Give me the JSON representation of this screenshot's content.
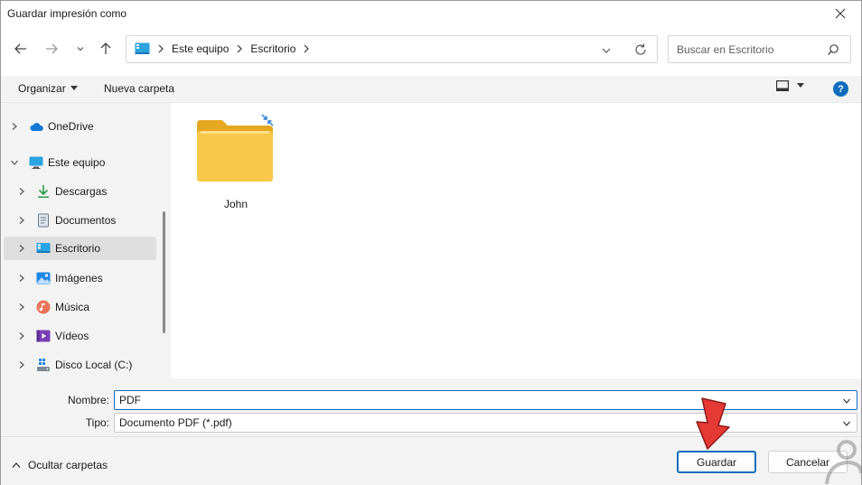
{
  "window": {
    "title": "Guardar impresión como",
    "close_icon": "close-icon"
  },
  "nav": {
    "back_icon": "arrow-left-icon",
    "forward_icon": "arrow-right-icon",
    "recent_icon": "chevron-down-icon",
    "up_icon": "arrow-up-icon",
    "breadcrumbs": [
      "Este equipo",
      "Escritorio"
    ],
    "search_placeholder": "Buscar en Escritorio"
  },
  "toolbar": {
    "organize_label": "Organizar",
    "new_folder_label": "Nueva carpeta",
    "help_label": "?"
  },
  "sidebar": {
    "items": [
      {
        "label": "OneDrive",
        "icon": "cloud-icon"
      },
      {
        "label": "Este equipo",
        "icon": "monitor-icon"
      },
      {
        "label": "Descargas",
        "icon": "download-icon"
      },
      {
        "label": "Documentos",
        "icon": "document-icon"
      },
      {
        "label": "Escritorio",
        "icon": "desktop-icon",
        "selected": true
      },
      {
        "label": "Imágenes",
        "icon": "image-icon"
      },
      {
        "label": "Música",
        "icon": "music-icon"
      },
      {
        "label": "Vídeos",
        "icon": "video-icon"
      },
      {
        "label": "Disco Local (C:)",
        "icon": "drive-icon"
      }
    ]
  },
  "content": {
    "items": [
      {
        "name": "John",
        "icon": "folder-icon",
        "badge": "sync-arrows-icon"
      }
    ]
  },
  "form": {
    "name_label": "Nombre:",
    "name_value": "PDF",
    "type_label": "Tipo:",
    "type_value": "Documento PDF (*.pdf)"
  },
  "footer": {
    "hide_folders_label": "Ocultar carpetas",
    "save_label": "Guardar",
    "cancel_label": "Cancelar"
  },
  "colors": {
    "accent": "#0f6cbd",
    "folder": "#f8c84a",
    "pointer_arrow": "#e53935"
  }
}
